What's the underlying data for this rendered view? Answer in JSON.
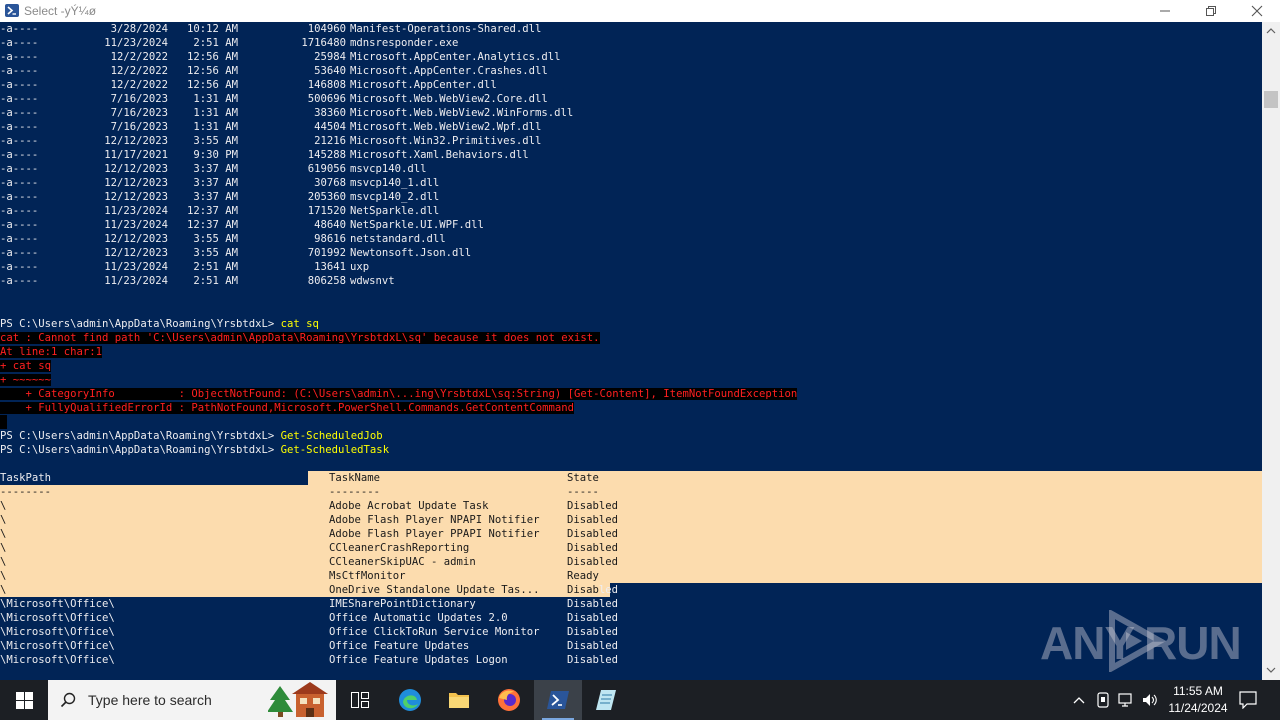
{
  "window": {
    "title": "Select -yÝ¼ø"
  },
  "colors": {
    "background": "#012456",
    "text": "#eeedf0",
    "command": "#ffff00",
    "error_text": "#ff2020",
    "error_bg": "#000000",
    "selection": "#fcdcae"
  },
  "files": [
    {
      "mode": "-a----",
      "date": "3/28/2024",
      "time": "10:12 AM",
      "size": "104960",
      "name": "Manifest-Operations-Shared.dll"
    },
    {
      "mode": "-a----",
      "date": "11/23/2024",
      "time": "2:51 AM",
      "size": "1716480",
      "name": "mdnsresponder.exe"
    },
    {
      "mode": "-a----",
      "date": "12/2/2022",
      "time": "12:56 AM",
      "size": "25984",
      "name": "Microsoft.AppCenter.Analytics.dll"
    },
    {
      "mode": "-a----",
      "date": "12/2/2022",
      "time": "12:56 AM",
      "size": "53640",
      "name": "Microsoft.AppCenter.Crashes.dll"
    },
    {
      "mode": "-a----",
      "date": "12/2/2022",
      "time": "12:56 AM",
      "size": "146808",
      "name": "Microsoft.AppCenter.dll"
    },
    {
      "mode": "-a----",
      "date": "7/16/2023",
      "time": "1:31 AM",
      "size": "500696",
      "name": "Microsoft.Web.WebView2.Core.dll"
    },
    {
      "mode": "-a----",
      "date": "7/16/2023",
      "time": "1:31 AM",
      "size": "38360",
      "name": "Microsoft.Web.WebView2.WinForms.dll"
    },
    {
      "mode": "-a----",
      "date": "7/16/2023",
      "time": "1:31 AM",
      "size": "44504",
      "name": "Microsoft.Web.WebView2.Wpf.dll"
    },
    {
      "mode": "-a----",
      "date": "12/12/2023",
      "time": "3:55 AM",
      "size": "21216",
      "name": "Microsoft.Win32.Primitives.dll"
    },
    {
      "mode": "-a----",
      "date": "11/17/2021",
      "time": "9:30 PM",
      "size": "145288",
      "name": "Microsoft.Xaml.Behaviors.dll"
    },
    {
      "mode": "-a----",
      "date": "12/12/2023",
      "time": "3:37 AM",
      "size": "619056",
      "name": "msvcp140.dll"
    },
    {
      "mode": "-a----",
      "date": "12/12/2023",
      "time": "3:37 AM",
      "size": "30768",
      "name": "msvcp140_1.dll"
    },
    {
      "mode": "-a----",
      "date": "12/12/2023",
      "time": "3:37 AM",
      "size": "205360",
      "name": "msvcp140_2.dll"
    },
    {
      "mode": "-a----",
      "date": "11/23/2024",
      "time": "12:37 AM",
      "size": "171520",
      "name": "NetSparkle.dll"
    },
    {
      "mode": "-a----",
      "date": "11/23/2024",
      "time": "12:37 AM",
      "size": "48640",
      "name": "NetSparkle.UI.WPF.dll"
    },
    {
      "mode": "-a----",
      "date": "12/12/2023",
      "time": "3:55 AM",
      "size": "98616",
      "name": "netstandard.dll"
    },
    {
      "mode": "-a----",
      "date": "12/12/2023",
      "time": "3:55 AM",
      "size": "701992",
      "name": "Newtonsoft.Json.dll"
    },
    {
      "mode": "-a----",
      "date": "11/23/2024",
      "time": "2:51 AM",
      "size": "13641",
      "name": "uxp"
    },
    {
      "mode": "-a----",
      "date": "11/23/2024",
      "time": "2:51 AM",
      "size": "806258",
      "name": "wdwsnvt"
    }
  ],
  "prompt": "PS C:\\Users\\admin\\AppData\\Roaming\\YrsbtdxL> ",
  "commands": {
    "cat": "cat sq",
    "job": "Get-ScheduledJob",
    "task": "Get-ScheduledTask"
  },
  "error": {
    "line1": "cat : Cannot find path 'C:\\Users\\admin\\AppData\\Roaming\\YrsbtdxL\\sq' because it does not exist.",
    "line2": "At line:1 char:1",
    "line3": "+ cat sq",
    "line4": "+ ~~~~~~",
    "line5": "    + CategoryInfo          : ObjectNotFound: (C:\\Users\\admin\\...ing\\YrsbtdxL\\sq:String) [Get-Content], ItemNotFoundException",
    "line6": "    + FullyQualifiedErrorId : PathNotFound,Microsoft.PowerShell.Commands.GetContentCommand"
  },
  "tasks_header": {
    "path": "TaskPath",
    "name": "TaskName",
    "state": "State",
    "path_sep": "--------",
    "name_sep": "--------",
    "state_sep": "-----"
  },
  "tasks": [
    {
      "path": "\\",
      "name": "Adobe Acrobat Update Task",
      "state": "Disabled"
    },
    {
      "path": "\\",
      "name": "Adobe Flash Player NPAPI Notifier",
      "state": "Disabled"
    },
    {
      "path": "\\",
      "name": "Adobe Flash Player PPAPI Notifier",
      "state": "Disabled"
    },
    {
      "path": "\\",
      "name": "CCleanerCrashReporting",
      "state": "Disabled"
    },
    {
      "path": "\\",
      "name": "CCleanerSkipUAC - admin",
      "state": "Disabled"
    },
    {
      "path": "\\",
      "name": "MsCtfMonitor",
      "state": "Ready"
    },
    {
      "path": "\\",
      "name": "OneDrive Standalone Update Tas...",
      "state": "Disabled"
    },
    {
      "path": "\\Microsoft\\Office\\",
      "name": "IMESharePointDictionary",
      "state": "Disabled"
    },
    {
      "path": "\\Microsoft\\Office\\",
      "name": "Office Automatic Updates 2.0",
      "state": "Disabled"
    },
    {
      "path": "\\Microsoft\\Office\\",
      "name": "Office ClickToRun Service Monitor",
      "state": "Disabled"
    },
    {
      "path": "\\Microsoft\\Office\\",
      "name": "Office Feature Updates",
      "state": "Disabled"
    },
    {
      "path": "\\Microsoft\\Office\\",
      "name": "Office Feature Updates Logon",
      "state": "Disabled"
    }
  ],
  "watermark": {
    "left": "ANY",
    "right": "RUN"
  },
  "taskbar": {
    "search_placeholder": "Type here to search",
    "time": "11:55 AM",
    "date": "11/24/2024"
  }
}
